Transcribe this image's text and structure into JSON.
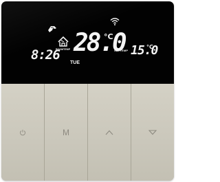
{
  "display": {
    "clock": "8:26",
    "day": "TUE",
    "room_temperature": "28.0",
    "room_unit": "°C",
    "set_label": "SETTEMP",
    "set_temperature": "15.0",
    "set_unit": "°C",
    "mode_label": "ROOMTEMP",
    "icons": [
      "hand-manual-icon",
      "wifi-icon",
      "home-icon"
    ]
  },
  "keys": {
    "power_icon": "power-icon",
    "mode_label": "M",
    "up_icon": "triangle-up-icon",
    "down_icon": "triangle-down-icon"
  },
  "colors": {
    "screen": "#020202",
    "segments": "#f4f4f4",
    "body": "#c9c6b9",
    "key_glyph": "#8d8a80"
  }
}
